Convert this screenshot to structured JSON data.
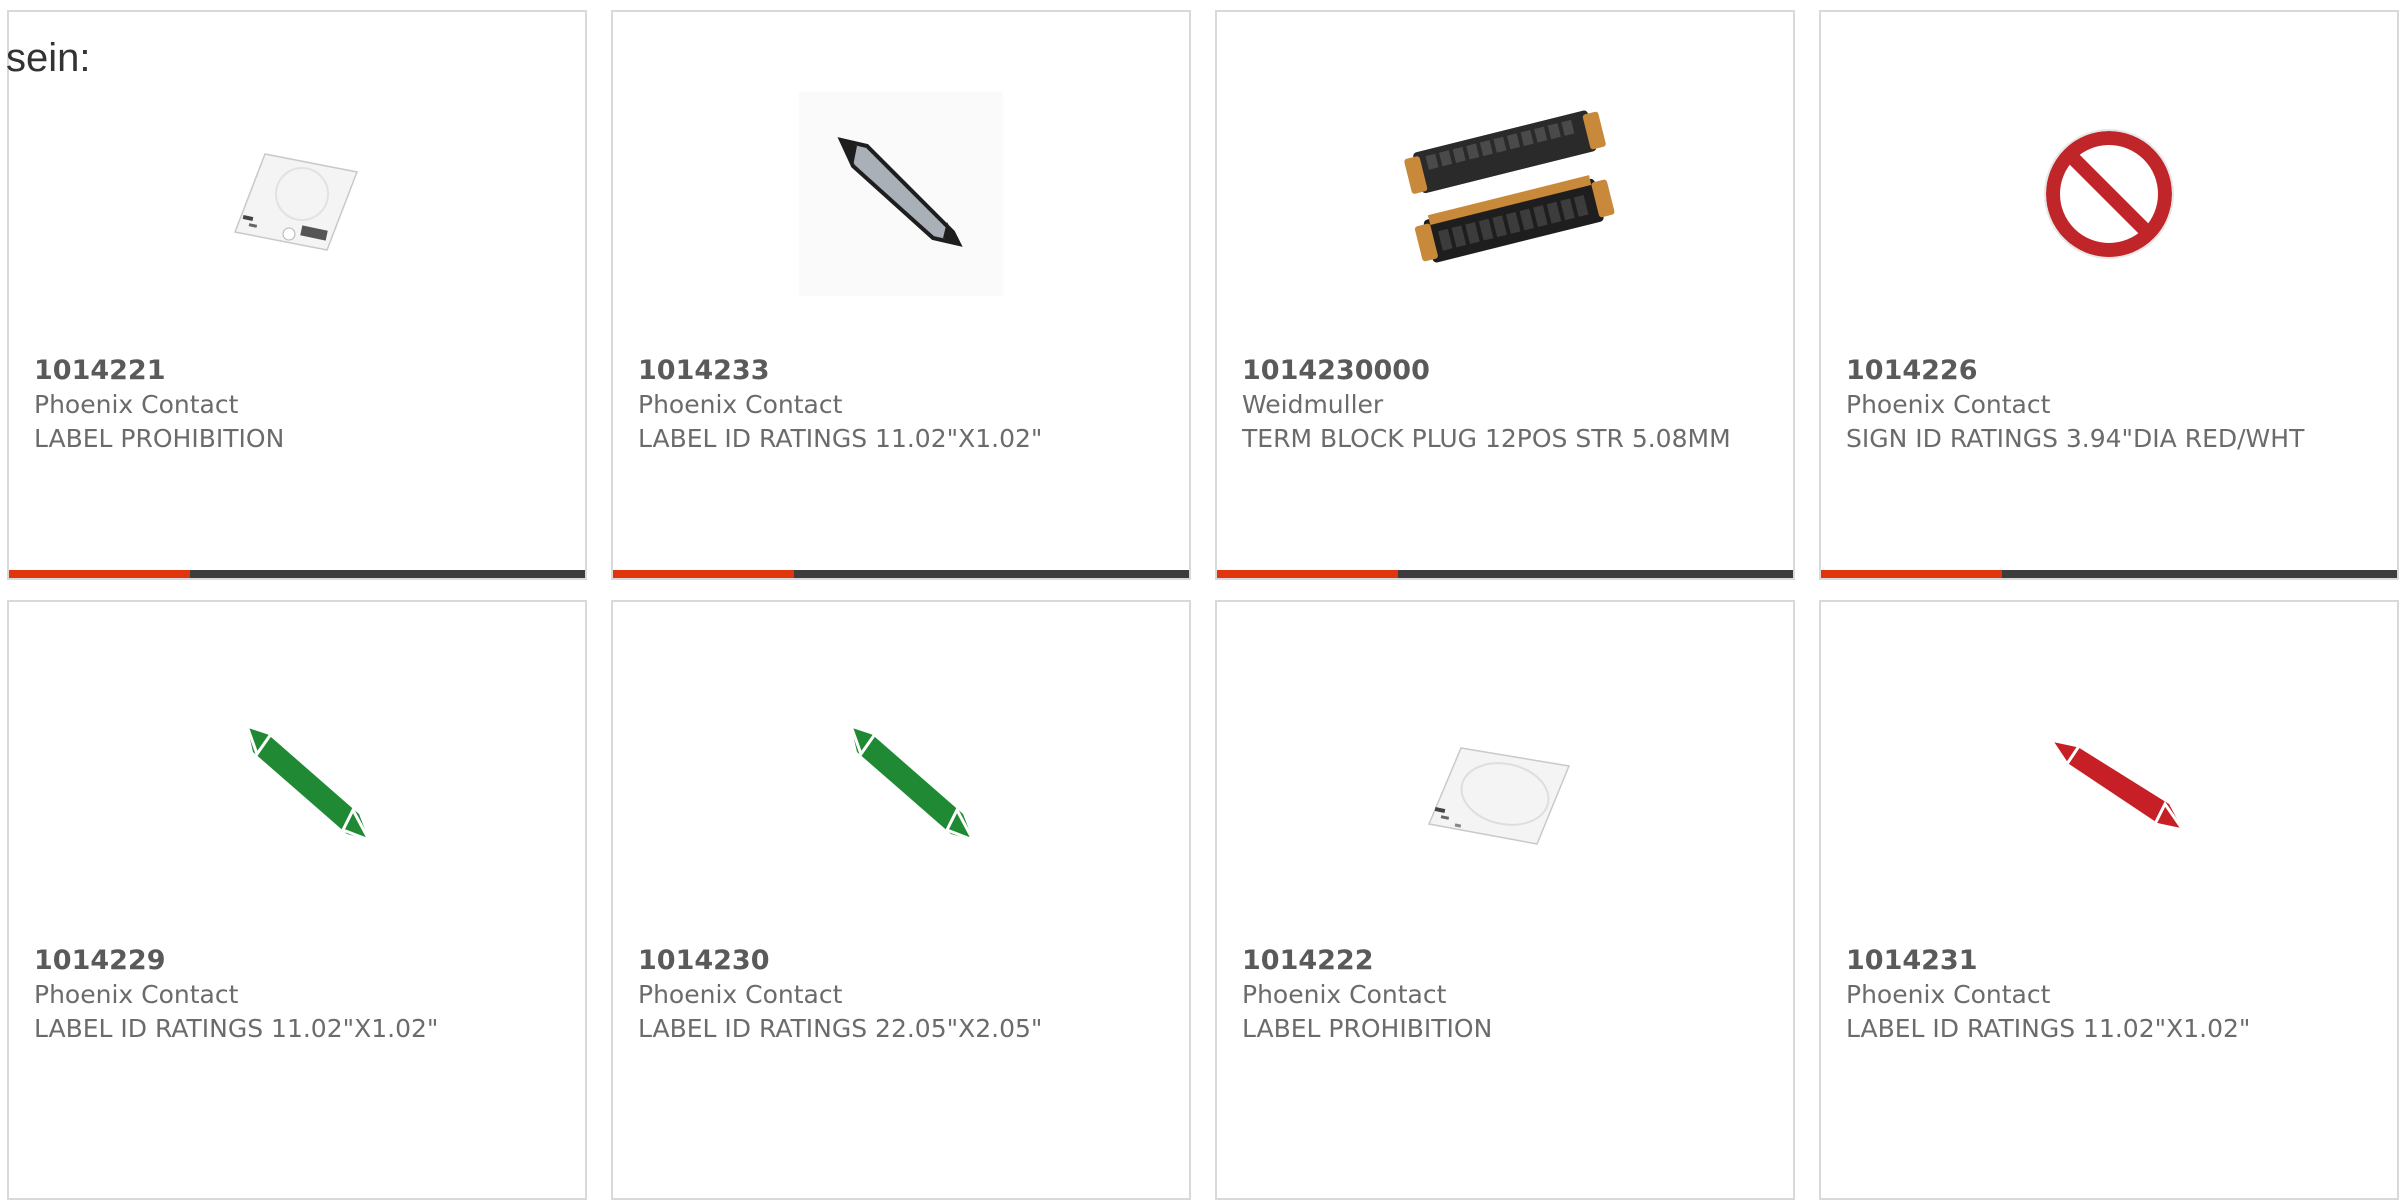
{
  "lead_text": "sein:",
  "colors": {
    "accent": "#e0350d",
    "bar": "#3c3c3c",
    "border": "#d9d9d9"
  },
  "products": [
    {
      "sku": "1014221",
      "maker": "Phoenix Contact",
      "description": "LABEL PROHIBITION",
      "image": "label-sheet-icon"
    },
    {
      "sku": "1014233",
      "maker": "Phoenix Contact",
      "description": "LABEL ID RATINGS 11.02\"X1.02\"",
      "image": "gray-pipe-marker-icon"
    },
    {
      "sku": "1014230000",
      "maker": "Weidmuller",
      "description": "TERM BLOCK PLUG 12POS STR 5.08MM",
      "image": "terminal-block-plug-icon"
    },
    {
      "sku": "1014226",
      "maker": "Phoenix Contact",
      "description": "SIGN ID RATINGS 3.94\"DIA RED/WHT",
      "image": "prohibition-sign-icon"
    },
    {
      "sku": "1014229",
      "maker": "Phoenix Contact",
      "description": "LABEL ID RATINGS 11.02\"X1.02\"",
      "image": "green-pipe-marker-icon"
    },
    {
      "sku": "1014230",
      "maker": "Phoenix Contact",
      "description": "LABEL ID RATINGS 22.05\"X2.05\"",
      "image": "green-pipe-marker-icon"
    },
    {
      "sku": "1014222",
      "maker": "Phoenix Contact",
      "description": "LABEL PROHIBITION",
      "image": "label-sheet-icon"
    },
    {
      "sku": "1014231",
      "maker": "Phoenix Contact",
      "description": "LABEL ID RATINGS 11.02\"X1.02\"",
      "image": "red-pipe-marker-icon"
    }
  ]
}
